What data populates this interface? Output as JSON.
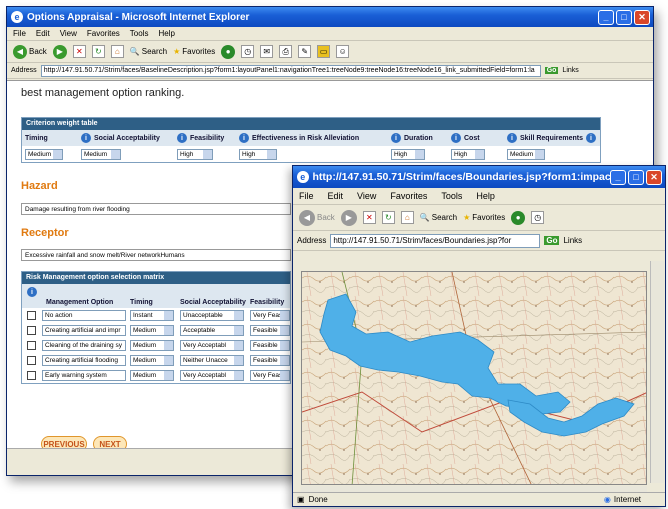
{
  "main": {
    "title": "Options Appraisal - Microsoft Internet Explorer",
    "menu": [
      "File",
      "Edit",
      "View",
      "Favorites",
      "Tools",
      "Help"
    ],
    "toolbar": {
      "back": "Back",
      "search": "Search",
      "favorites": "Favorites"
    },
    "address_label": "Address",
    "address": "http://147.91.50.71/Strim/faces/BaselineDescription.jsp?form1:layoutPanel1:navigationTree1:treeNode9:treeNode16:treeNode16_link_submittedField=form1:la",
    "go": "Go",
    "links": "Links",
    "intro_text": "best management option ranking.",
    "criterion_table": {
      "title": "Criterion weight table",
      "headers": [
        "Timing",
        "Social Acceptability",
        "Feasibility",
        "Effectiveness in Risk Alleviation",
        "Duration",
        "Cost",
        "Skill Requirements"
      ],
      "values": [
        "Medium",
        "Medium",
        "High",
        "High",
        "High",
        "High",
        "Medium"
      ]
    },
    "hazard": {
      "heading": "Hazard",
      "value": "Damage resulting from river flooding"
    },
    "receptor": {
      "heading": "Receptor",
      "value": "Excessive rainfall and snow melt/River networkHumans"
    },
    "risk_matrix": {
      "title": "Risk Management option selection matrix",
      "headers": [
        "Management Option",
        "Timing",
        "Social Acceptability",
        "Feasibility"
      ],
      "rows": [
        {
          "option": "No action",
          "timing": "Instant",
          "social": "Unacceptable",
          "feasibility": "Very Feasib"
        },
        {
          "option": "Creating artificial and impr",
          "timing": "Medium",
          "social": "Acceptable",
          "feasibility": "Feasible"
        },
        {
          "option": "Cleaning of the draining sy",
          "timing": "Medium",
          "social": "Very Acceptabl",
          "feasibility": "Feasible"
        },
        {
          "option": "Creating artificial flooding",
          "timing": "Medium",
          "social": "Neither Unacce",
          "feasibility": "Feasible"
        },
        {
          "option": "Early warning system",
          "timing": "Medium",
          "social": "Very Acceptabl",
          "feasibility": "Very Feasib"
        }
      ]
    },
    "previous": "PREVIOUS",
    "next": "NEXT"
  },
  "popup": {
    "title": "http://147.91.50.71/Strim/faces/Boundaries.jsp?form1:impact...",
    "menu": [
      "File",
      "Edit",
      "View",
      "Favorites",
      "Tools",
      "Help"
    ],
    "toolbar": {
      "back": "Back",
      "search": "Search",
      "favorites": "Favorites"
    },
    "address_label": "Address",
    "address": "http://147.91.50.71/Strim/faces/Boundaries.jsp?for",
    "go": "Go",
    "links": "Links",
    "status": "Done",
    "zone": "Internet"
  },
  "colors": {
    "flood_area": "#4fb0e8",
    "titlebar": "#1a5fd6",
    "panel_header": "#2e5f86",
    "section_heading": "#e07a10"
  }
}
